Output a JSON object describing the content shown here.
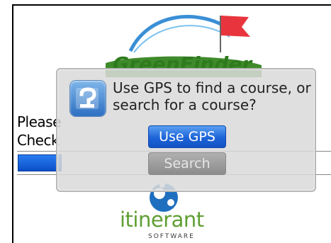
{
  "background": {
    "logo_text": "GreenFinder",
    "prompt_line1": "Please",
    "prompt_line2": "Check",
    "brand_logo_word": "itinerant",
    "brand_logo_sub": "SOFTWARE"
  },
  "dialog": {
    "icon": "question-icon",
    "message": "Use GPS to find a course, or search for a course?",
    "buttons": {
      "use_gps_label": "Use GPS",
      "search_label": "Search"
    }
  },
  "colors": {
    "primary_button": "#1d64d8",
    "disabled_button": "#9a9a9a",
    "brand_green": "#5f9e32",
    "progress_blue": "#0b4fc9"
  }
}
